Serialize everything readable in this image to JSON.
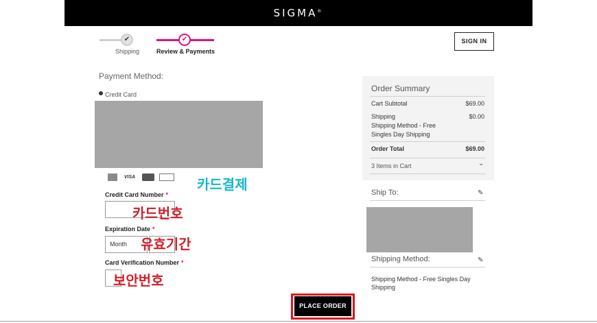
{
  "header": {
    "brand": "SIGMA",
    "brand_mark": "®"
  },
  "progress": {
    "steps": [
      {
        "label": "Shipping",
        "state": "done"
      },
      {
        "label": "Review & Payments",
        "state": "current"
      }
    ],
    "check_glyph": "✔"
  },
  "account": {
    "sign_in_label": "SIGN IN"
  },
  "payment": {
    "title": "Payment Method:",
    "credit_card_label": "Credit Card",
    "card_logos": [
      "AMEX",
      "VISA",
      "MC",
      "DISCOVER"
    ],
    "fields": {
      "card_number_label": "Credit Card Number",
      "expiration_label": "Expiration Date",
      "month_value": "Month",
      "year_value": "",
      "cvv_label": "Card Verification Number",
      "required_mark": "*"
    },
    "place_order_label": "PLACE ORDER"
  },
  "annotations": {
    "card_payment": "카드결제",
    "card_number": "카드번호",
    "expiry": "유효기간",
    "security_code": "보안번호"
  },
  "summary": {
    "title": "Order Summary",
    "cart_subtotal_label": "Cart Subtotal",
    "cart_subtotal_value": "$69.00",
    "shipping_label": "Shipping",
    "shipping_detail": "Shipping Method - Free Singles Day Shipping",
    "shipping_value": "$0.00",
    "order_total_label": "Order Total",
    "order_total_value": "$69.00",
    "items_in_cart": "3 Items in Cart"
  },
  "ship_to": {
    "title": "Ship To:"
  },
  "shipping_method": {
    "title": "Shipping Method:",
    "value": "Shipping Method - Free Singles Day Shipping"
  },
  "icons": {
    "pencil": "✎",
    "chevron": "⌄"
  },
  "colors": {
    "accent": "#e0117f",
    "highlight_border": "#e0141e",
    "annotation_teal": "#18b6c9",
    "annotation_red": "#d0202a"
  }
}
